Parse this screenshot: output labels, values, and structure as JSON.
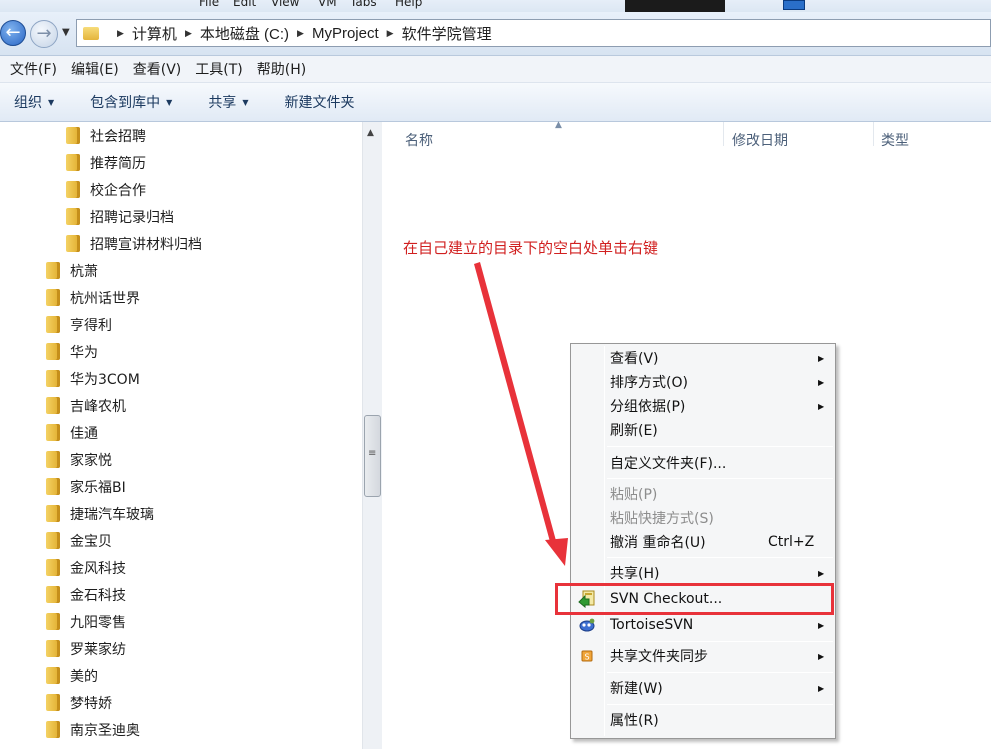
{
  "top_strip": {
    "items": [
      "File",
      "Edit",
      "View",
      "VM",
      "Tabs",
      "Help"
    ]
  },
  "address": {
    "breadcrumbs": [
      "计算机",
      "本地磁盘 (C:)",
      "MyProject",
      "软件学院管理"
    ]
  },
  "menu_bar": {
    "items": [
      "文件(F)",
      "编辑(E)",
      "查看(V)",
      "工具(T)",
      "帮助(H)"
    ]
  },
  "command_bar": {
    "organize": "组织",
    "include_library": "包含到库中",
    "share": "共享",
    "new_folder": "新建文件夹"
  },
  "tree": {
    "sub_items": [
      "社会招聘",
      "推荐简历",
      "校企合作",
      "招聘记录归档",
      "招聘宣讲材料归档"
    ],
    "items": [
      "杭萧",
      "杭州话世界",
      "亨得利",
      "华为",
      "华为3COM",
      "吉峰农机",
      "佳通",
      "家家悦",
      "家乐福BI",
      "捷瑞汽车玻璃",
      "金宝贝",
      "金风科技",
      "金石科技",
      "九阳零售",
      "罗莱家纺",
      "美的",
      "梦特娇",
      "南京圣迪奥"
    ]
  },
  "columns": {
    "name": "名称",
    "modified": "修改日期",
    "type": "类型"
  },
  "annotation": "在自己建立的目录下的空白处单击右键",
  "context_menu": {
    "view": "查看(V)",
    "sort_by": "排序方式(O)",
    "group_by": "分组依据(P)",
    "refresh": "刷新(E)",
    "customize": "自定义文件夹(F)...",
    "paste": "粘贴(P)",
    "paste_shortcut": "粘贴快捷方式(S)",
    "undo_rename": "撤消 重命名(U)",
    "undo_shortcut": "Ctrl+Z",
    "share": "共享(H)",
    "svn_checkout": "SVN Checkout...",
    "tortoise_svn": "TortoiseSVN",
    "shared_folder_sync": "共享文件夹同步",
    "new": "新建(W)",
    "properties": "属性(R)"
  },
  "colors": {
    "annotation": "#d12020",
    "highlight": "#e8323a"
  }
}
